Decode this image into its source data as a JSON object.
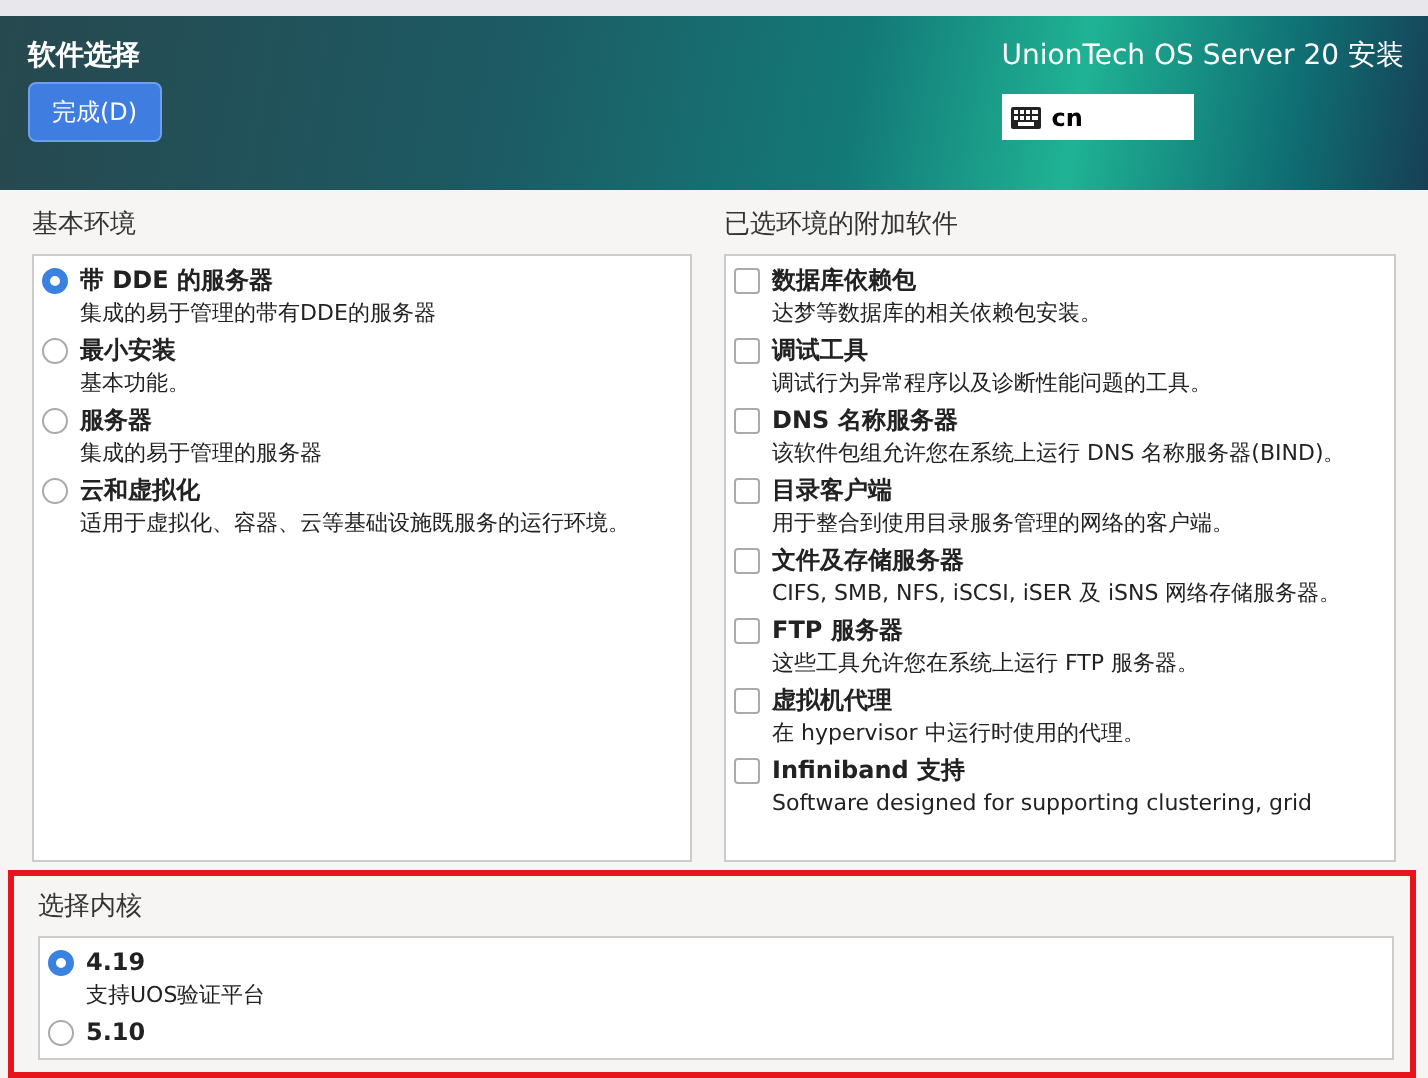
{
  "header": {
    "title": "软件选择",
    "done_button": "完成(D)",
    "product": "UnionTech OS Server 20 安装",
    "keyboard_layout": "cn"
  },
  "base_environment": {
    "heading": "基本环境",
    "items": [
      {
        "name": "带 DDE 的服务器",
        "description": "集成的易于管理的带有DDE的服务器",
        "selected": true
      },
      {
        "name": "最小安装",
        "description": "基本功能。",
        "selected": false
      },
      {
        "name": "服务器",
        "description": "集成的易于管理的服务器",
        "selected": false
      },
      {
        "name": "云和虚拟化",
        "description": "适用于虚拟化、容器、云等基础设施既服务的运行环境。",
        "selected": false
      }
    ]
  },
  "addons": {
    "heading": "已选环境的附加软件",
    "items": [
      {
        "name": "数据库依赖包",
        "description": "达梦等数据库的相关依赖包安装。",
        "checked": false
      },
      {
        "name": "调试工具",
        "description": "调试行为异常程序以及诊断性能问题的工具。",
        "checked": false
      },
      {
        "name": "DNS 名称服务器",
        "description": "该软件包组允许您在系统上运行 DNS 名称服务器(BIND)。",
        "checked": false
      },
      {
        "name": "目录客户端",
        "description": "用于整合到使用目录服务管理的网络的客户端。",
        "checked": false
      },
      {
        "name": "文件及存储服务器",
        "description": "CIFS, SMB, NFS, iSCSI, iSER 及 iSNS 网络存储服务器。",
        "checked": false
      },
      {
        "name": "FTP 服务器",
        "description": "这些工具允许您在系统上运行 FTP 服务器。",
        "checked": false
      },
      {
        "name": "虚拟机代理",
        "description": "在 hypervisor 中运行时使用的代理。",
        "checked": false
      },
      {
        "name": "Infiniband 支持",
        "description": "Software designed for supporting clustering, grid",
        "checked": false
      }
    ]
  },
  "kernel": {
    "heading": "选择内核",
    "items": [
      {
        "name": "4.19",
        "description": "支持UOS验证平台",
        "selected": true
      },
      {
        "name": "5.10",
        "selected": false
      }
    ]
  }
}
